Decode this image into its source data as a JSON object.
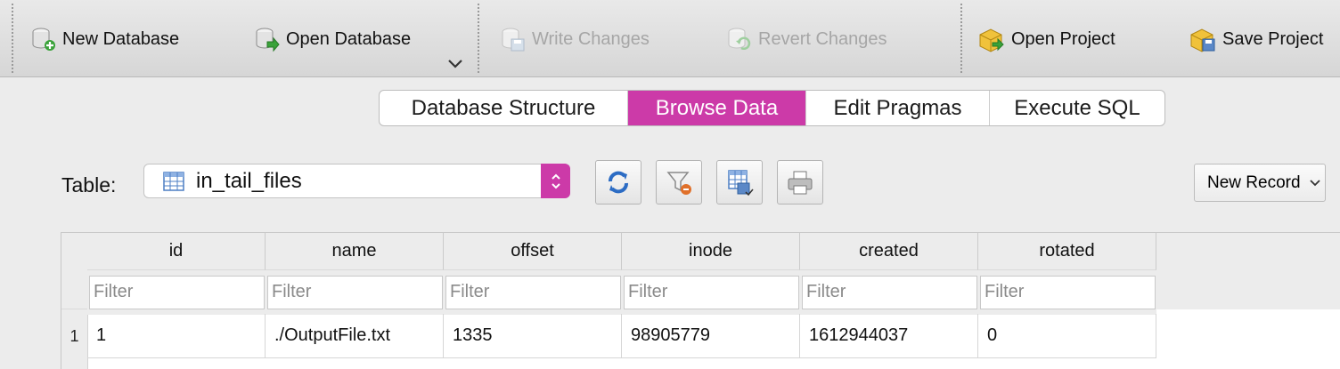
{
  "toolbar": {
    "new_database": "New Database",
    "open_database": "Open Database",
    "write_changes": "Write Changes",
    "revert_changes": "Revert Changes",
    "open_project": "Open Project",
    "save_project": "Save Project"
  },
  "tabs": [
    {
      "label": "Database Structure",
      "active": false
    },
    {
      "label": "Browse Data",
      "active": true
    },
    {
      "label": "Edit Pragmas",
      "active": false
    },
    {
      "label": "Execute SQL",
      "active": false
    }
  ],
  "table_selector": {
    "label": "Table:",
    "value": "in_tail_files"
  },
  "new_record_label": "New Record",
  "grid": {
    "columns": [
      "id",
      "name",
      "offset",
      "inode",
      "created",
      "rotated"
    ],
    "filter_placeholder": "Filter",
    "rows": [
      {
        "row_number": "1",
        "cells": [
          "1",
          "./OutputFile.txt",
          "1335",
          "98905779",
          "1612944037",
          "0"
        ]
      }
    ]
  },
  "colors": {
    "accent": "#cc3aa8",
    "toolbar_bg": "#dcdcdc",
    "window_bg": "#ececec"
  },
  "icons": [
    "new-database-icon",
    "open-database-icon",
    "write-changes-icon",
    "revert-changes-icon",
    "open-project-icon",
    "save-project-icon",
    "refresh-icon",
    "clear-filters-icon",
    "export-icon",
    "print-icon",
    "table-icon"
  ]
}
